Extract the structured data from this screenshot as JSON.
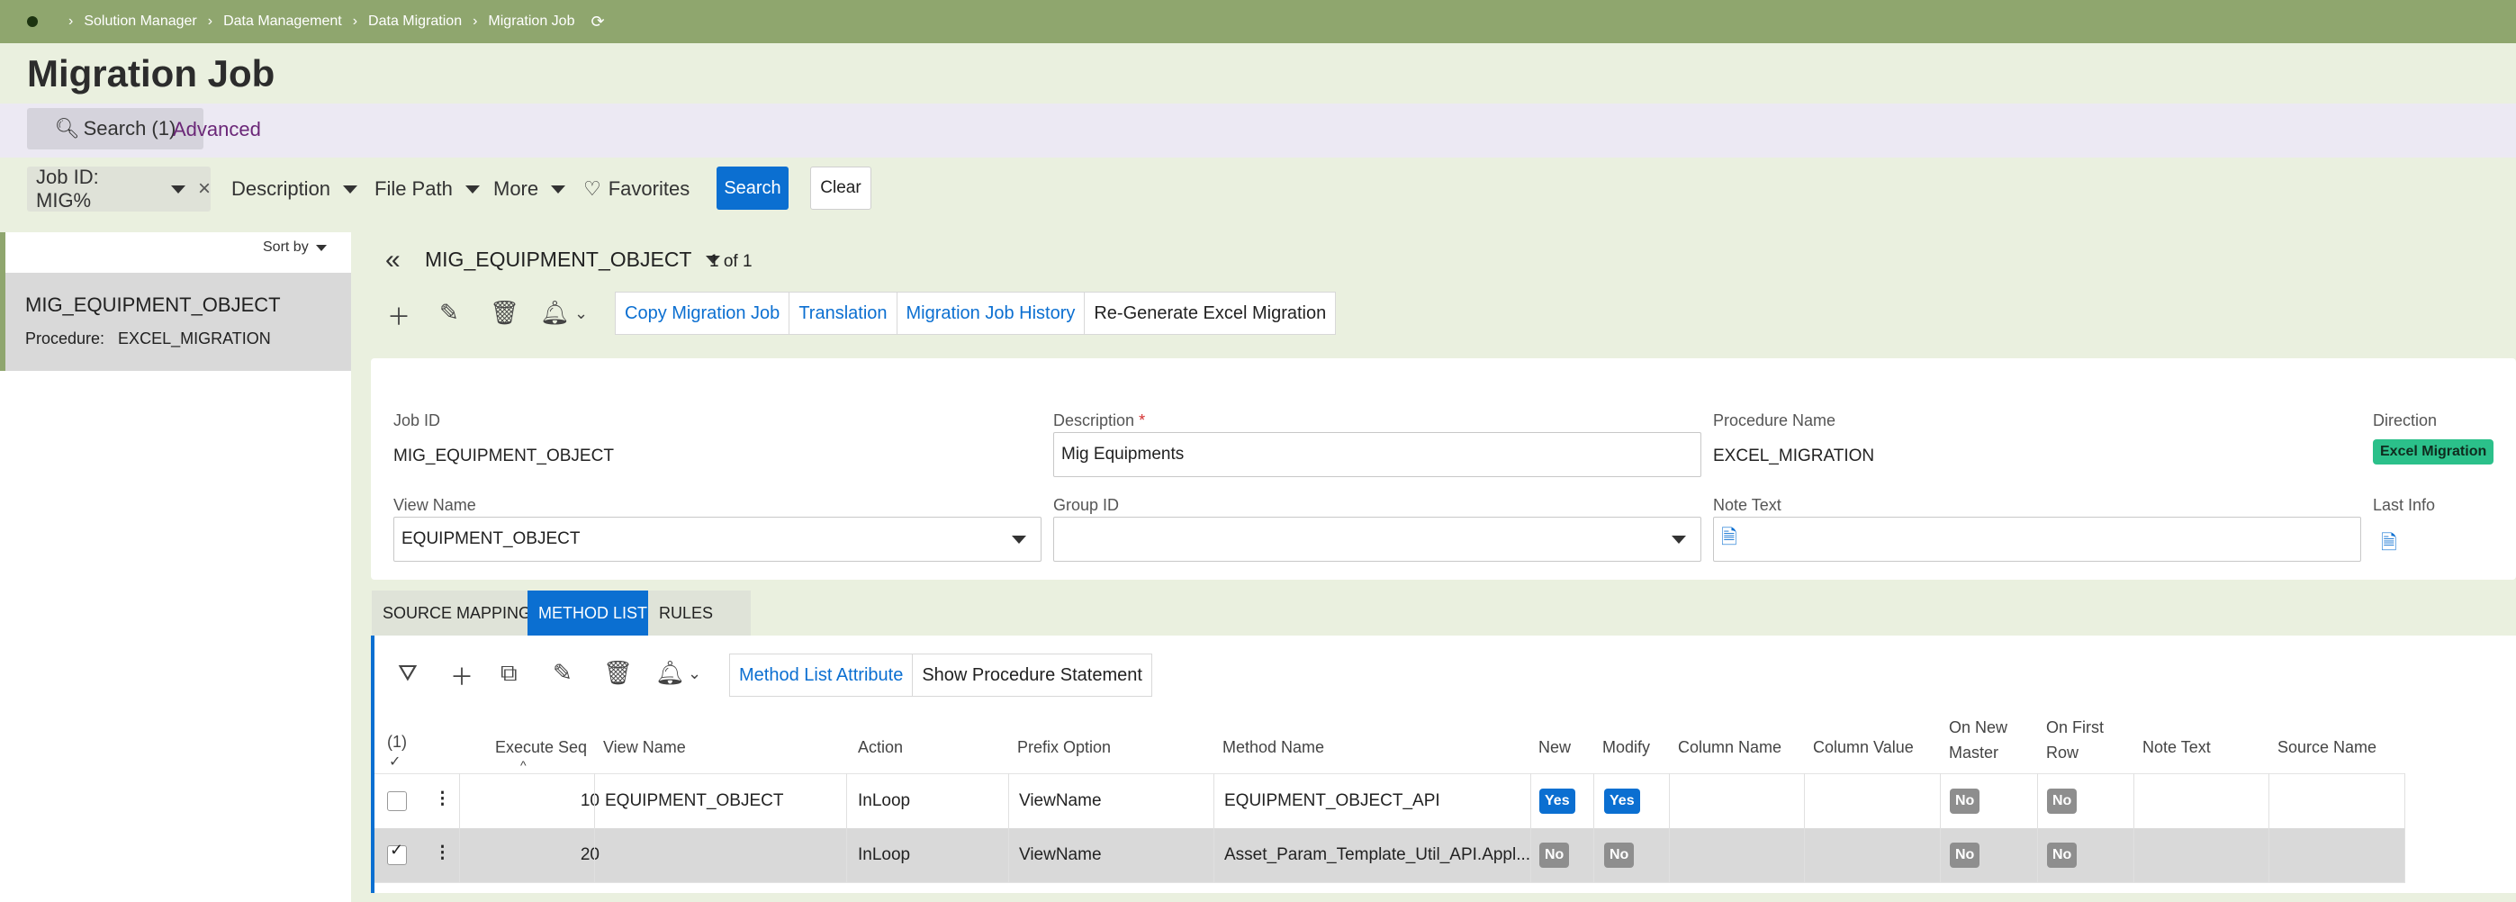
{
  "breadcrumb": [
    "Solution Manager",
    "Data Management",
    "Data Migration",
    "Migration Job"
  ],
  "page_title": "Migration Job",
  "search": {
    "tab_label": "Search (1)",
    "advanced_label": "Advanced"
  },
  "filters": {
    "job_chip": "Job ID: MIG%",
    "description": "Description",
    "file_path": "File Path",
    "more": "More",
    "favorites": "Favorites",
    "search_btn": "Search",
    "clear_btn": "Clear"
  },
  "list": {
    "sort_by": "Sort by",
    "item_title": "MIG_EQUIPMENT_OBJECT",
    "item_sub": "Procedure:   EXCEL_MIGRATION"
  },
  "record": {
    "title": "MIG_EQUIPMENT_OBJECT",
    "count": "1 of 1"
  },
  "commands": [
    "Copy Migration Job",
    "Translation",
    "Migration Job History",
    "Re-Generate Excel Migration"
  ],
  "form": {
    "job_id_label": "Job ID",
    "job_id": "MIG_EQUIPMENT_OBJECT",
    "description_label": "Description",
    "description": "Mig Equipments",
    "procedure_label": "Procedure Name",
    "procedure": "EXCEL_MIGRATION",
    "direction_label": "Direction",
    "direction": "Excel Migration",
    "view_label": "View Name",
    "view": "EQUIPMENT_OBJECT",
    "group_label": "Group ID",
    "group": "",
    "note_label": "Note Text",
    "last_info_label": "Last Info"
  },
  "tabs": [
    "SOURCE MAPPING",
    "METHOD LIST",
    "RULES"
  ],
  "table_commands": [
    "Method List Attribute",
    "Show Procedure Statement"
  ],
  "table": {
    "selected_count": "(1)",
    "headers": [
      "Execute Seq",
      "View Name",
      "Action",
      "Prefix Option",
      "Method Name",
      "New",
      "Modify",
      "Column Name",
      "Column Value",
      "On New Master",
      "On First Row",
      "Note Text",
      "Source Name"
    ],
    "rows": [
      {
        "seq": "10",
        "view": "EQUIPMENT_OBJECT",
        "action": "InLoop",
        "prefix": "ViewName",
        "method": "EQUIPMENT_OBJECT_API",
        "new": "Yes",
        "modify": "Yes",
        "on_new_master": "No",
        "on_first_row": "No"
      },
      {
        "seq": "20",
        "view": "",
        "action": "InLoop",
        "prefix": "ViewName",
        "method": "Asset_Param_Template_Util_API.Appl...",
        "new": "No",
        "modify": "No",
        "on_new_master": "No",
        "on_first_row": "No"
      }
    ]
  }
}
